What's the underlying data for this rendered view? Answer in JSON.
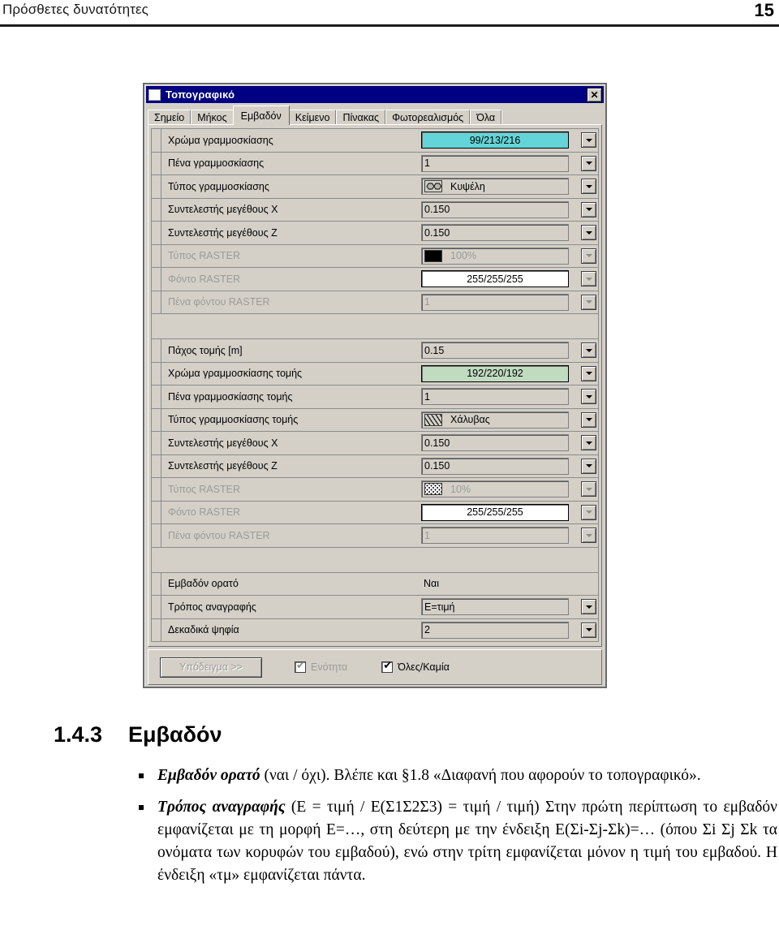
{
  "page": {
    "header_title": "Πρόσθετες δυνατότητες",
    "page_number": "15"
  },
  "dialog": {
    "title": "Τοπογραφικό",
    "close_label": "✕",
    "tabs": [
      {
        "label": "Σημείο",
        "active": false
      },
      {
        "label": "Μήκος",
        "active": false
      },
      {
        "label": "Εμβαδόν",
        "active": true
      },
      {
        "label": "Κείμενο",
        "active": false
      },
      {
        "label": "Πίνακας",
        "active": false
      },
      {
        "label": "Φωτορεαλισμός",
        "active": false
      },
      {
        "label": "Όλα",
        "active": false
      }
    ],
    "groups": [
      {
        "rows": [
          {
            "label": "Χρώμα γραμμοσκίασης",
            "value": "99/213/216",
            "align": "center",
            "field_style": "cyan",
            "dropdown": true,
            "disabled": false,
            "swatch": "none"
          },
          {
            "label": "Πένα γραμμοσκίασης",
            "value": "1",
            "align": "left",
            "field_style": "plain",
            "dropdown": true,
            "disabled": false,
            "swatch": "none"
          },
          {
            "label": "Τύπος γραμμοσκίασης",
            "value": "Κυψέλη",
            "align": "left",
            "field_style": "plain",
            "dropdown": true,
            "disabled": false,
            "swatch": "honeycomb"
          },
          {
            "label": "Συντελεστής μεγέθους X",
            "value": "0.150",
            "align": "left",
            "field_style": "plain",
            "dropdown": true,
            "disabled": false,
            "swatch": "none"
          },
          {
            "label": "Συντελεστής μεγέθους Z",
            "value": "0.150",
            "align": "left",
            "field_style": "plain",
            "dropdown": true,
            "disabled": false,
            "swatch": "none"
          },
          {
            "label": "Τύπος RASTER",
            "value": "100%",
            "align": "left",
            "field_style": "disabled",
            "dropdown": true,
            "disabled": true,
            "swatch": "black"
          },
          {
            "label": "Φόντο RASTER",
            "value": "255/255/255",
            "align": "center",
            "field_style": "white",
            "dropdown": true,
            "disabled": true,
            "swatch": "none"
          },
          {
            "label": "Πένα φόντου RASTER",
            "value": "1",
            "align": "left",
            "field_style": "disabled",
            "dropdown": true,
            "disabled": true,
            "swatch": "none"
          }
        ]
      },
      {
        "rows": [
          {
            "label": "Πάχος τομής [m]",
            "value": "0.15",
            "align": "left",
            "field_style": "plain",
            "dropdown": true,
            "disabled": false,
            "swatch": "none"
          },
          {
            "label": "Χρώμα γραμμοσκίασης τομής",
            "value": "192/220/192",
            "align": "center",
            "field_style": "green",
            "dropdown": true,
            "disabled": false,
            "swatch": "none"
          },
          {
            "label": "Πένα γραμμοσκίασης τομής",
            "value": "1",
            "align": "left",
            "field_style": "plain",
            "dropdown": true,
            "disabled": false,
            "swatch": "none"
          },
          {
            "label": "Τύπος γραμμοσκίασης τομής",
            "value": "Χάλυβας",
            "align": "left",
            "field_style": "plain",
            "dropdown": true,
            "disabled": false,
            "swatch": "hatch"
          },
          {
            "label": "Συντελεστής μεγέθους X",
            "value": "0.150",
            "align": "left",
            "field_style": "plain",
            "dropdown": true,
            "disabled": false,
            "swatch": "none"
          },
          {
            "label": "Συντελεστής μεγέθους Z",
            "value": "0.150",
            "align": "left",
            "field_style": "plain",
            "dropdown": true,
            "disabled": false,
            "swatch": "none"
          },
          {
            "label": "Τύπος RASTER",
            "value": "10%",
            "align": "left",
            "field_style": "disabled",
            "dropdown": true,
            "disabled": true,
            "swatch": "dots"
          },
          {
            "label": "Φόντο RASTER",
            "value": "255/255/255",
            "align": "center",
            "field_style": "white",
            "dropdown": true,
            "disabled": true,
            "swatch": "none"
          },
          {
            "label": "Πένα φόντου RASTER",
            "value": "1",
            "align": "left",
            "field_style": "disabled",
            "dropdown": true,
            "disabled": true,
            "swatch": "none"
          }
        ]
      },
      {
        "rows": [
          {
            "label": "Εμβαδόν ορατό",
            "value": "Ναι",
            "align": "left",
            "field_style": "none",
            "dropdown": false,
            "disabled": false,
            "swatch": "none"
          },
          {
            "label": "Τρόπος αναγραφής",
            "value": "Ε=τιμή",
            "align": "left",
            "field_style": "plain",
            "dropdown": true,
            "disabled": false,
            "swatch": "none"
          },
          {
            "label": "Δεκαδικά ψηφία",
            "value": "2",
            "align": "left",
            "field_style": "plain",
            "dropdown": true,
            "disabled": false,
            "swatch": "none"
          }
        ]
      }
    ],
    "footer": {
      "sample_button": "Υπόδειγμα >>",
      "checkbox_unit": {
        "label": "Ενότητα",
        "checked": true,
        "disabled": true
      },
      "checkbox_all": {
        "label": "Όλες/Καμία",
        "checked": true,
        "disabled": false
      },
      "tick_glyph": "✔"
    },
    "colors": {
      "titlebar": "#000082",
      "face": "#d4d0c8",
      "hatch_color_cyan": "#63d5d8",
      "hatch_color_green": "#c0dcc0",
      "raster_background": "#ffffff"
    }
  },
  "document": {
    "section_number": "1.4.3",
    "section_title": "Εμβαδόν",
    "bullets": [
      {
        "lead": "Εμβαδόν ορατό",
        "rest": " (ναι / όχι). Βλέπε και §1.8 «Διαφανή που αφορούν το τοπογραφικό»."
      },
      {
        "lead": "Τρόπος αναγραφής",
        "rest": " (Ε = τιμή / Ε(Σ1Σ2Σ3) = τιμή / τιμή) Στην πρώτη περίπτωση το εμβαδόν εμφανίζεται με τη μορφή Ε=…, στη δεύτερη με την ένδειξη Ε(Σi-Σj-Σk)=… (όπου Σi Σj Σk τα ονόματα των κορυφών του εμβαδού), ενώ στην τρίτη εμφανίζεται μόνον η τιμή του εμβαδού. Η ένδειξη «τμ» εμφανίζεται πάντα."
      }
    ]
  }
}
